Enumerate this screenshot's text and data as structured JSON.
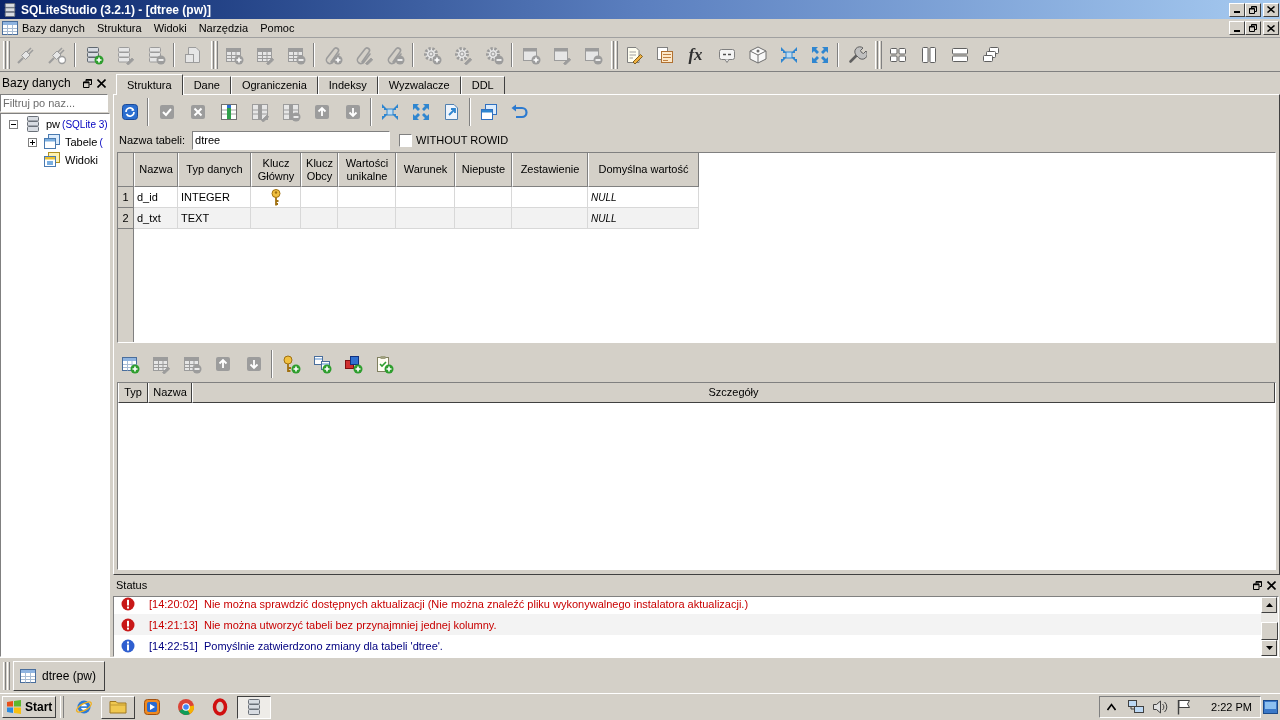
{
  "window": {
    "title": "SQLiteStudio (3.2.1) - [dtree (pw)]"
  },
  "menu": [
    "Bazy danych",
    "Struktura",
    "Widoki",
    "Narzędzia",
    "Pomoc"
  ],
  "toolbars": [
    {
      "groups": [
        [
          {
            "kind": "connect",
            "disabled": true
          },
          {
            "kind": "disconnect",
            "disabled": true
          }
        ],
        [
          {
            "kind": "database-add",
            "disabled": false
          },
          {
            "kind": "database-edit",
            "disabled": true
          },
          {
            "kind": "database-remove",
            "disabled": true
          }
        ],
        [
          {
            "kind": "database-page",
            "disabled": true
          }
        ]
      ]
    },
    {
      "groups": [
        [
          {
            "kind": "table-add",
            "disabled": true
          },
          {
            "kind": "table-edit",
            "disabled": true
          },
          {
            "kind": "table-remove",
            "disabled": true
          }
        ],
        [
          {
            "kind": "index-add",
            "disabled": true
          },
          {
            "kind": "index-edit",
            "disabled": true
          },
          {
            "kind": "index-remove",
            "disabled": true
          }
        ],
        [
          {
            "kind": "trigger-add",
            "disabled": true
          },
          {
            "kind": "trigger-edit",
            "disabled": true
          },
          {
            "kind": "trigger-remove",
            "disabled": true
          }
        ],
        [
          {
            "kind": "view-add",
            "disabled": true
          },
          {
            "kind": "view-edit",
            "disabled": true
          },
          {
            "kind": "view-remove",
            "disabled": true
          }
        ]
      ]
    },
    {
      "groups": [
        [
          {
            "kind": "sql-editor",
            "disabled": false
          },
          {
            "kind": "ddl-history",
            "disabled": false
          },
          {
            "kind": "functions",
            "label": "fx",
            "disabled": false
          },
          {
            "kind": "collations",
            "disabled": false
          },
          {
            "kind": "extensions",
            "disabled": false
          },
          {
            "kind": "import",
            "disabled": false
          },
          {
            "kind": "export",
            "disabled": false
          }
        ],
        [
          {
            "kind": "config",
            "disabled": false
          }
        ]
      ]
    },
    {
      "groups": [
        [
          {
            "kind": "tile",
            "disabled": false
          },
          {
            "kind": "tile-vertical",
            "disabled": false
          },
          {
            "kind": "tile-horizontal",
            "disabled": false
          },
          {
            "kind": "cascade",
            "disabled": false
          }
        ]
      ]
    }
  ],
  "databases_panel": {
    "title": "Bazy danych",
    "filter": {
      "placeholder": "Filtruj po naz..."
    },
    "tree": [
      {
        "kind": "database",
        "label": "pw",
        "detail": "(SQLite 3)",
        "expanded": true,
        "children": [
          {
            "kind": "tables",
            "label": "Tabele",
            "detail": "(",
            "expanded": false
          },
          {
            "kind": "views",
            "label": "Widoki"
          }
        ]
      }
    ]
  },
  "editor": {
    "tabs": [
      {
        "label": "Struktura",
        "selected": true
      },
      {
        "label": "Dane",
        "selected": false
      },
      {
        "label": "Ograniczenia",
        "selected": false
      },
      {
        "label": "Indeksy",
        "selected": false
      },
      {
        "label": "Wyzwalacze",
        "selected": false
      },
      {
        "label": "DDL",
        "selected": false
      }
    ],
    "structure_toolbar": [
      [
        {
          "kind": "refresh",
          "disabled": false
        }
      ],
      [
        {
          "kind": "commit",
          "disabled": true
        },
        {
          "kind": "rollback",
          "disabled": true
        },
        {
          "kind": "column-add",
          "disabled": false
        },
        {
          "kind": "column-edit",
          "disabled": true
        },
        {
          "kind": "column-remove",
          "disabled": true
        },
        {
          "kind": "move-up",
          "disabled": true
        },
        {
          "kind": "move-down",
          "disabled": true
        }
      ],
      [
        {
          "kind": "import",
          "disabled": false
        },
        {
          "kind": "export",
          "disabled": false
        },
        {
          "kind": "page-export",
          "disabled": false
        }
      ],
      [
        {
          "kind": "windows",
          "disabled": false
        },
        {
          "kind": "undo",
          "disabled": false
        }
      ]
    ],
    "table_name": {
      "label": "Nazwa tabeli:",
      "value": "dtree"
    },
    "without_rowid": {
      "label": "WITHOUT ROWID",
      "checked": false
    },
    "columns_table": {
      "columns": [
        "Nazwa",
        "Typ danych",
        "Klucz Główny",
        "Klucz Obcy",
        "Wartości unikalne",
        "Warunek",
        "Niepuste",
        "Zestawienie",
        "Domyślna wartość"
      ],
      "rows": [
        {
          "number": "1",
          "name": "d_id",
          "type": "INTEGER",
          "primary_key": true,
          "default": "NULL"
        },
        {
          "number": "2",
          "name": "d_txt",
          "type": "TEXT",
          "primary_key": false,
          "default": "NULL"
        }
      ]
    },
    "constraints_toolbar": [
      [
        {
          "kind": "constraint-add",
          "disabled": false
        },
        {
          "kind": "constraint-edit",
          "disabled": true
        },
        {
          "kind": "constraint-remove",
          "disabled": true
        },
        {
          "kind": "move-up",
          "disabled": true
        },
        {
          "kind": "move-down",
          "disabled": true
        }
      ],
      [
        {
          "kind": "primary-key-add",
          "disabled": false
        },
        {
          "kind": "foreign-key-add",
          "disabled": false
        },
        {
          "kind": "unique-add",
          "disabled": false
        },
        {
          "kind": "check-add",
          "disabled": false
        }
      ]
    ],
    "constraints_table": {
      "columns": [
        "Typ",
        "Nazwa",
        "Szczegóły"
      ]
    }
  },
  "status_panel": {
    "title": "Status",
    "messages": [
      {
        "kind": "error",
        "time": "[14:20:02]",
        "text": "Nie można sprawdzić dostępnych aktualizacji (Nie można znaleźć pliku wykonywalnego instalatora aktualizacji.)"
      },
      {
        "kind": "error",
        "time": "[14:21:13]",
        "text": "Nie można utworzyć tabeli bez przynajmniej jednej kolumny."
      },
      {
        "kind": "info",
        "time": "[14:22:51]",
        "text": "Pomyślnie zatwierdzono zmiany dla tabeli 'dtree'."
      }
    ]
  },
  "window_bar": [
    {
      "label": "dtree (pw)"
    }
  ],
  "taskbar": {
    "start": "Start",
    "apps": [
      {
        "kind": "globe",
        "running": false,
        "active": false
      },
      {
        "kind": "folder",
        "running": true,
        "active": false
      },
      {
        "kind": "play",
        "running": false,
        "active": false
      },
      {
        "kind": "wheel",
        "running": false,
        "active": false
      },
      {
        "kind": "ring",
        "running": false,
        "active": false
      },
      {
        "kind": "server",
        "running": true,
        "active": true
      }
    ],
    "clock": "2:22 PM"
  }
}
